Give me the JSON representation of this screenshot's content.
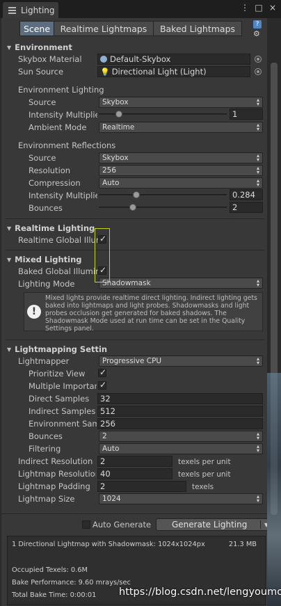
{
  "window": {
    "title": "Lighting"
  },
  "tabs": [
    {
      "label": "Scene",
      "active": true
    },
    {
      "label": "Realtime Lightmaps"
    },
    {
      "label": "Baked Lightmaps"
    }
  ],
  "environment": {
    "header": "Environment",
    "skybox_label": "Skybox Material",
    "skybox_value": "Default-Skybox",
    "sun_label": "Sun Source",
    "sun_value": "Directional Light (Light)",
    "lighting_header": "Environment Lighting",
    "source_label": "Source",
    "source_value": "Skybox",
    "intensity_label": "Intensity Multiplie",
    "intensity_value": "1",
    "intensity_fraction": 0.14,
    "ambient_label": "Ambient Mode",
    "ambient_value": "Realtime",
    "reflections_header": "Environment Reflections",
    "r_source_label": "Source",
    "r_source_value": "Skybox",
    "resolution_label": "Resolution",
    "resolution_value": "256",
    "compression_label": "Compression",
    "compression_value": "Auto",
    "r_intensity_label": "Intensity Multiplie",
    "r_intensity_value": "0.284",
    "r_intensity_fraction": 0.284,
    "bounces_label": "Bounces",
    "bounces_value": "2",
    "bounces_fraction": 0.25
  },
  "realtime": {
    "header": "Realtime Lighting",
    "gi_label": "Realtime Global Illur",
    "gi_checked": true
  },
  "mixed": {
    "header": "Mixed Lighting",
    "baked_label": "Baked Global Illumir",
    "baked_checked": true,
    "mode_label": "Lighting Mode",
    "mode_value": "Shadowmask",
    "info": "Mixed lights provide realtime direct lighting. Indirect lighting gets baked into lightmaps and light probes. Shadowmasks and light probes occlusion get generated for baked shadows. The Shadowmask Mode used at run time can be set in the Quality Settings panel."
  },
  "lightmapping": {
    "header": "Lightmapping Settin",
    "lightmapper_label": "Lightmapper",
    "lightmapper_value": "Progressive CPU",
    "prioritize_label": "Prioritize View",
    "prioritize_checked": true,
    "importance_label": "Multiple Importan",
    "importance_checked": true,
    "direct_label": "Direct Samples",
    "direct_value": "32",
    "indirect_label": "Indirect Samples",
    "indirect_value": "512",
    "env_label": "Environment Sam",
    "env_value": "256",
    "bounces_label": "Bounces",
    "bounces_value": "2",
    "filtering_label": "Filtering",
    "filtering_value": "Auto",
    "ind_res_label": "Indirect Resolution",
    "ind_res_value": "2",
    "ind_res_unit": "texels per unit",
    "lm_res_label": "Lightmap Resolution",
    "lm_res_value": "40",
    "lm_res_unit": "texels per unit",
    "padding_label": "Lightmap Padding",
    "padding_value": "2",
    "padding_unit": "texels",
    "size_label": "Lightmap Size",
    "size_value": "1024"
  },
  "bottom": {
    "auto_generate_label": "Auto Generate",
    "auto_generate_checked": false,
    "generate_label": "Generate Lighting"
  },
  "stats": {
    "line1": "1 Directional Lightmap with Shadowmask: 1024x1024px",
    "line1_size": "21.3 MB",
    "occupied": "Occupied Texels: 0.6M",
    "performance": "Bake Performance: 9.60 mrays/sec",
    "total_time": "Total Bake Time: 0:00:01"
  },
  "watermark": "https://blog.csdn.net/lengyoumo"
}
